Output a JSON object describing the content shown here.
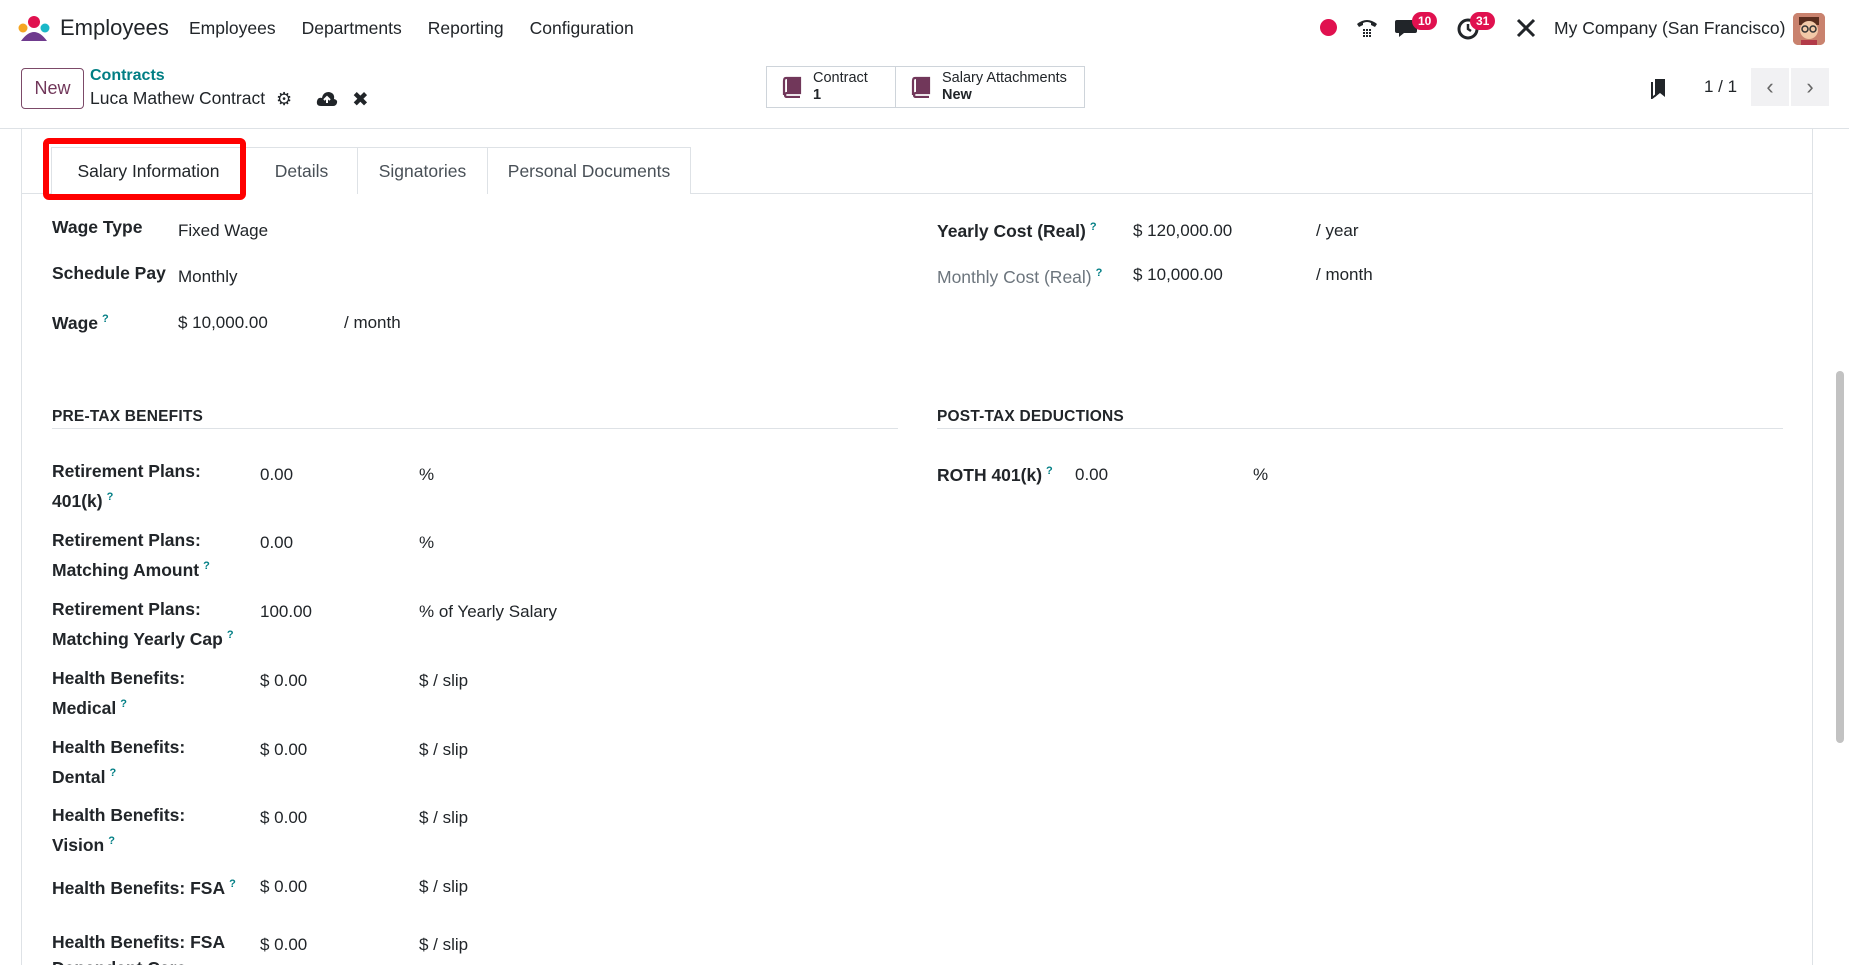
{
  "navbar": {
    "app_name": "Employees",
    "menu": [
      "Employees",
      "Departments",
      "Reporting",
      "Configuration"
    ],
    "messages_badge": "10",
    "activities_badge": "31",
    "company": "My Company (San Francisco)"
  },
  "control_panel": {
    "new_label": "New",
    "breadcrumb_parent": "Contracts",
    "breadcrumb_current": "Luca Mathew Contract",
    "smart_buttons": [
      {
        "label": "Contract",
        "value": "1"
      },
      {
        "label": "Salary Attachments",
        "value": "New"
      }
    ],
    "pager": "1 / 1"
  },
  "tabs": [
    "Salary Information",
    "Details",
    "Signatories",
    "Personal Documents"
  ],
  "salary": {
    "wage_type_label": "Wage Type",
    "wage_type_value": "Fixed Wage",
    "schedule_pay_label": "Schedule Pay",
    "schedule_pay_value": "Monthly",
    "wage_label": "Wage",
    "wage_value": "$ 10,000.00",
    "wage_unit": "/ month",
    "yearly_cost_label": "Yearly Cost (Real)",
    "yearly_cost_value": "$ 120,000.00",
    "yearly_cost_unit": "/ year",
    "monthly_cost_label": "Monthly Cost (Real)",
    "monthly_cost_value": "$ 10,000.00",
    "monthly_cost_unit": "/ month"
  },
  "pretax": {
    "title": "PRE-TAX BENEFITS",
    "rows": [
      {
        "label1": "Retirement Plans:",
        "label2": "401(k)",
        "value": "0.00",
        "unit": "%"
      },
      {
        "label1": "Retirement Plans:",
        "label2": "Matching Amount",
        "value": "0.00",
        "unit": "%"
      },
      {
        "label1": "Retirement Plans:",
        "label2": "Matching Yearly Cap",
        "value": "100.00",
        "unit": "% of Yearly Salary"
      },
      {
        "label1": "Health Benefits:",
        "label2": "Medical",
        "value": "$ 0.00",
        "unit": "$ / slip"
      },
      {
        "label1": "Health Benefits:",
        "label2": "Dental",
        "value": "$ 0.00",
        "unit": "$ / slip"
      },
      {
        "label1": "Health Benefits:",
        "label2": "Vision",
        "value": "$ 0.00",
        "unit": "$ / slip"
      },
      {
        "label1": "Health Benefits: FSA",
        "label2": "",
        "value": "$ 0.00",
        "unit": "$ / slip"
      },
      {
        "label1": "Health Benefits: FSA",
        "label2": "Dependent Care",
        "value": "$ 0.00",
        "unit": "$ / slip"
      }
    ]
  },
  "posttax": {
    "title": "POST-TAX DEDUCTIONS",
    "roth_label": "ROTH 401(k)",
    "roth_value": "0.00",
    "roth_unit": "%"
  }
}
